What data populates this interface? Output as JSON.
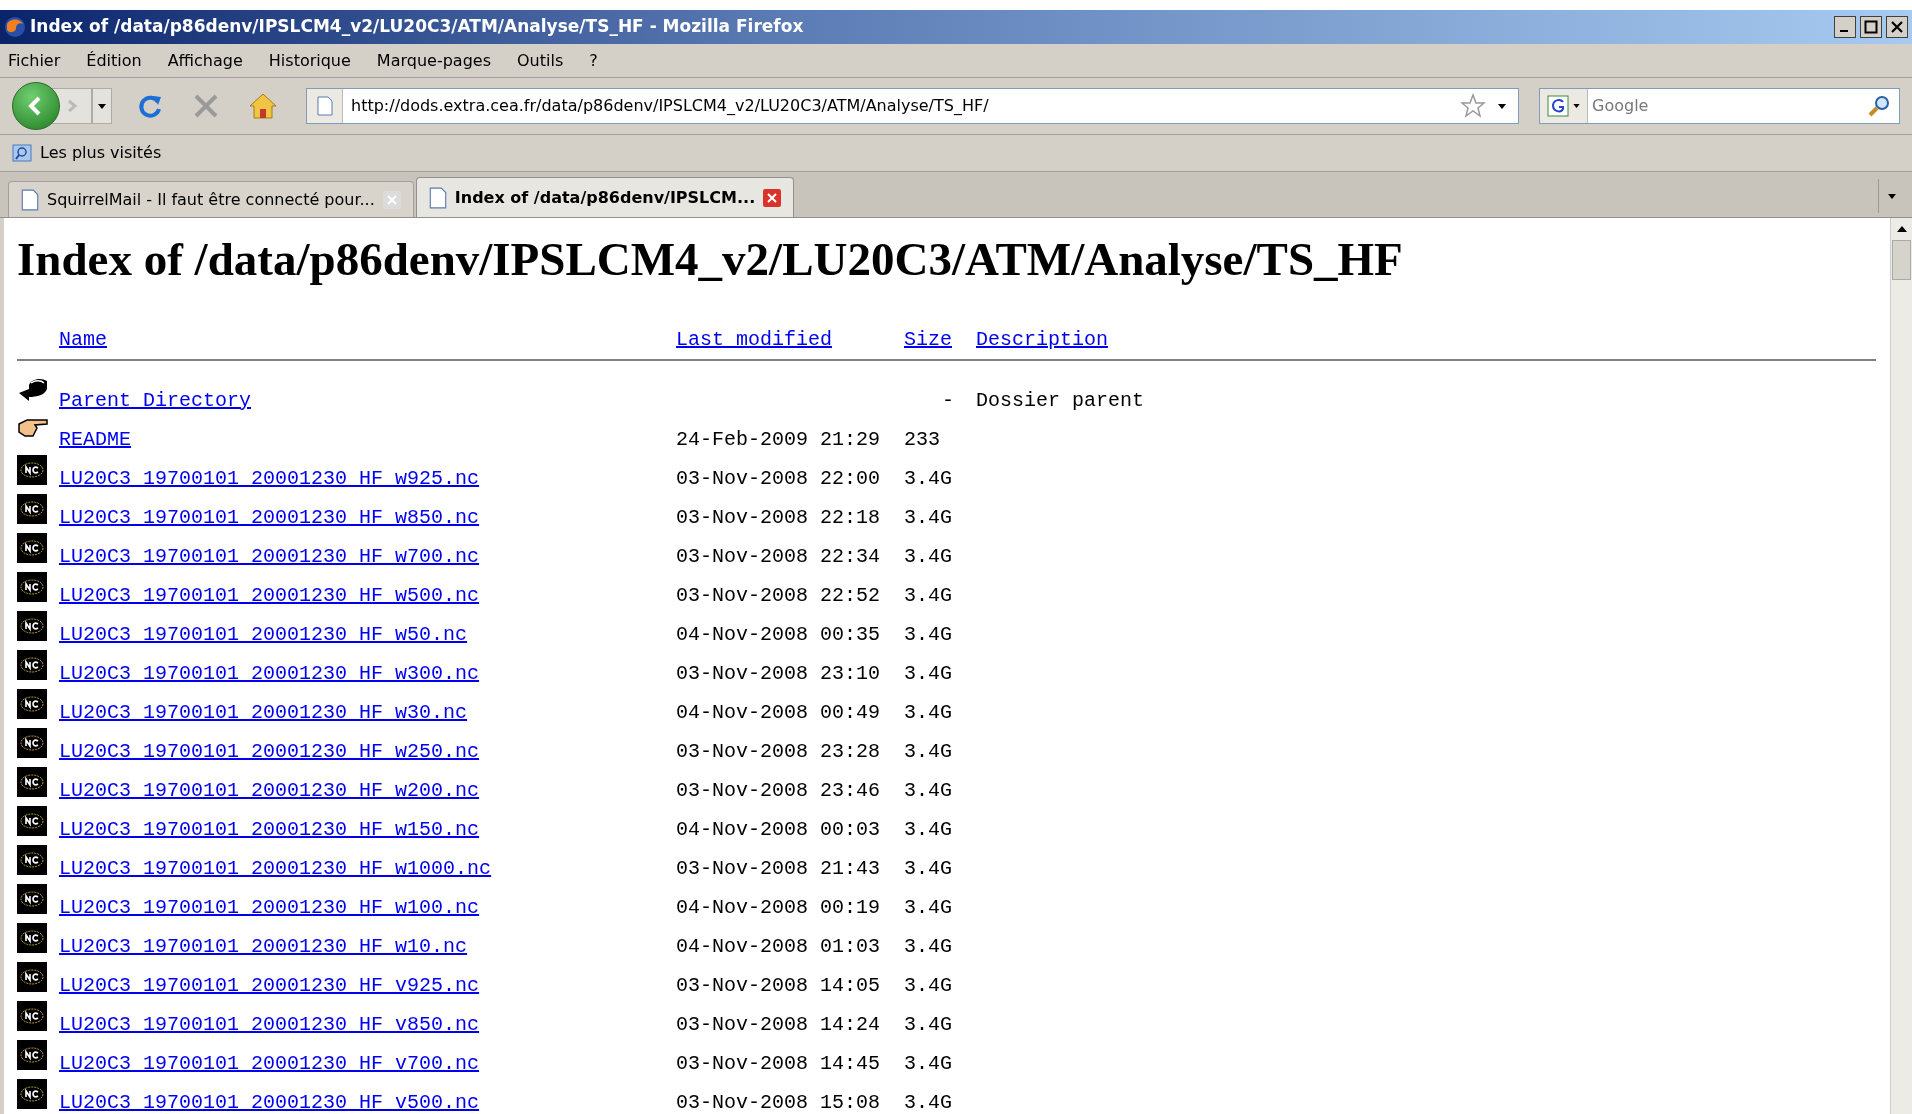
{
  "window": {
    "title": "Index of /data/p86denv/IPSLCM4_v2/LU20C3/ATM/Analyse/TS_HF - Mozilla Firefox"
  },
  "menu_bar": [
    "Fichier",
    "Édition",
    "Affichage",
    "Historique",
    "Marque-pages",
    "Outils",
    "?"
  ],
  "navigation": {
    "url": "http://dods.extra.cea.fr/data/p86denv/IPSLCM4_v2/LU20C3/ATM/Analyse/TS_HF/",
    "search_placeholder": "Google"
  },
  "bookmarks": [
    "Les plus visités"
  ],
  "tabs": [
    {
      "label": "SquirrelMail - Il faut être connecté pour...",
      "selected": false
    },
    {
      "label": "Index of /data/p86denv/IPSLCM...",
      "selected": true
    }
  ],
  "page": {
    "heading": "Index of /data/p86denv/IPSLCM4_v2/LU20C3/ATM/Analyse/TS_HF",
    "columns": [
      "Name",
      "Last modified",
      "Size",
      "Description"
    ],
    "rows": [
      {
        "kind": "parent",
        "name": "Parent Directory",
        "modified": "",
        "size": "-",
        "description": "Dossier parent"
      },
      {
        "kind": "readme",
        "name": "README",
        "modified": "24-Feb-2009 21:29",
        "size": "233"
      },
      {
        "kind": "nc",
        "name": "LU20C3_19700101_20001230_HF_w925.nc",
        "modified": "03-Nov-2008 22:00",
        "size": "3.4G"
      },
      {
        "kind": "nc",
        "name": "LU20C3_19700101_20001230_HF_w850.nc",
        "modified": "03-Nov-2008 22:18",
        "size": "3.4G"
      },
      {
        "kind": "nc",
        "name": "LU20C3_19700101_20001230_HF_w700.nc",
        "modified": "03-Nov-2008 22:34",
        "size": "3.4G"
      },
      {
        "kind": "nc",
        "name": "LU20C3_19700101_20001230_HF_w500.nc",
        "modified": "03-Nov-2008 22:52",
        "size": "3.4G"
      },
      {
        "kind": "nc",
        "name": "LU20C3_19700101_20001230_HF_w50.nc",
        "modified": "04-Nov-2008 00:35",
        "size": "3.4G"
      },
      {
        "kind": "nc",
        "name": "LU20C3_19700101_20001230_HF_w300.nc",
        "modified": "03-Nov-2008 23:10",
        "size": "3.4G"
      },
      {
        "kind": "nc",
        "name": "LU20C3_19700101_20001230_HF_w30.nc",
        "modified": "04-Nov-2008 00:49",
        "size": "3.4G"
      },
      {
        "kind": "nc",
        "name": "LU20C3_19700101_20001230_HF_w250.nc",
        "modified": "03-Nov-2008 23:28",
        "size": "3.4G"
      },
      {
        "kind": "nc",
        "name": "LU20C3_19700101_20001230_HF_w200.nc",
        "modified": "03-Nov-2008 23:46",
        "size": "3.4G"
      },
      {
        "kind": "nc",
        "name": "LU20C3_19700101_20001230_HF_w150.nc",
        "modified": "04-Nov-2008 00:03",
        "size": "3.4G"
      },
      {
        "kind": "nc",
        "name": "LU20C3_19700101_20001230_HF_w1000.nc",
        "modified": "03-Nov-2008 21:43",
        "size": "3.4G"
      },
      {
        "kind": "nc",
        "name": "LU20C3_19700101_20001230_HF_w100.nc",
        "modified": "04-Nov-2008 00:19",
        "size": "3.4G"
      },
      {
        "kind": "nc",
        "name": "LU20C3_19700101_20001230_HF_w10.nc",
        "modified": "04-Nov-2008 01:03",
        "size": "3.4G"
      },
      {
        "kind": "nc",
        "name": "LU20C3_19700101_20001230_HF_v925.nc",
        "modified": "03-Nov-2008 14:05",
        "size": "3.4G"
      },
      {
        "kind": "nc",
        "name": "LU20C3_19700101_20001230_HF_v850.nc",
        "modified": "03-Nov-2008 14:24",
        "size": "3.4G"
      },
      {
        "kind": "nc",
        "name": "LU20C3_19700101_20001230_HF_v700.nc",
        "modified": "03-Nov-2008 14:45",
        "size": "3.4G"
      },
      {
        "kind": "nc",
        "name": "LU20C3_19700101_20001230_HF_v500.nc",
        "modified": "03-Nov-2008 15:08",
        "size": "3.4G"
      }
    ]
  }
}
